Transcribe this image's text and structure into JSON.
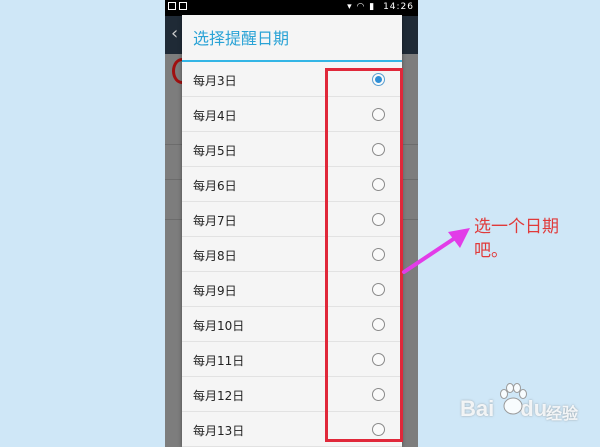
{
  "status_bar": {
    "time": "14:26"
  },
  "dialog": {
    "title": "选择提醒日期",
    "options": [
      {
        "label": "每月3日",
        "checked": true
      },
      {
        "label": "每月4日",
        "checked": false
      },
      {
        "label": "每月5日",
        "checked": false
      },
      {
        "label": "每月6日",
        "checked": false
      },
      {
        "label": "每月7日",
        "checked": false
      },
      {
        "label": "每月8日",
        "checked": false
      },
      {
        "label": "每月9日",
        "checked": false
      },
      {
        "label": "每月10日",
        "checked": false
      },
      {
        "label": "每月11日",
        "checked": false
      },
      {
        "label": "每月12日",
        "checked": false
      },
      {
        "label": "每月13日",
        "checked": false
      }
    ]
  },
  "annotation": {
    "text_line1": "选一个日期",
    "text_line2": "吧。",
    "color": "#e03a3a",
    "arrow_color": "#e23ce8"
  },
  "watermark": {
    "brand": "Bai",
    "brand2": "du",
    "sub": "经验"
  },
  "colors": {
    "accent": "#33b5e5",
    "radio_checked": "#2f8fd6",
    "highlight_box": "#e0283a"
  }
}
